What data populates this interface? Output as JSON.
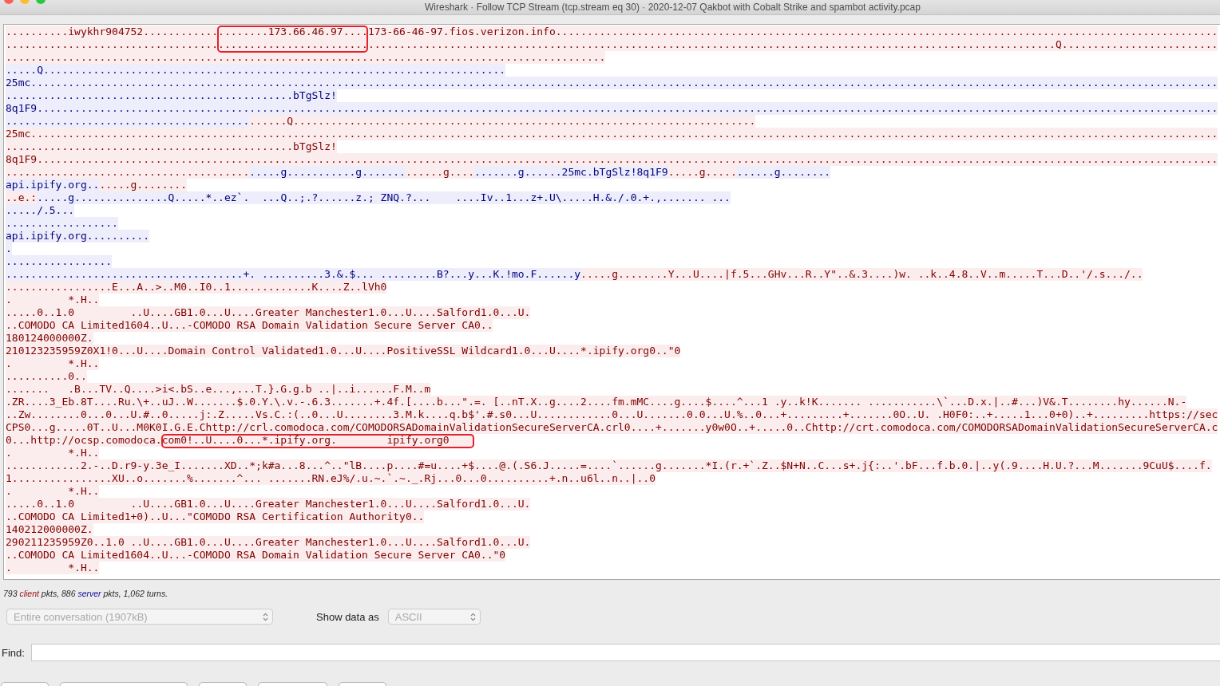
{
  "window": {
    "title": "Wireshark · Follow TCP Stream (tcp.stream eq 30) · 2020-12-07 Qakbot with Cobalt Strike and spambot activity.pcap"
  },
  "stream": {
    "lines": [
      {
        "segments": [
          {
            "kind": "client",
            "boxed": false,
            "text": "..........iwykhr904752............"
          },
          {
            "kind": "client",
            "boxed": true,
            "text": "........173.66.46.97...."
          },
          {
            "kind": "client",
            "boxed": false,
            "text": "173-66-46-97.fios.verizon.info.........................................................................................................."
          }
        ]
      },
      {
        "segments": [
          {
            "kind": "client",
            "boxed": false,
            "text": ".................................."
          },
          {
            "kind": "client",
            "boxed": true,
            "text": "........................"
          },
          {
            "kind": "client",
            "boxed": false,
            "text": "..............................................................................................................Q........................."
          }
        ]
      },
      {
        "segments": [
          {
            "kind": "client",
            "boxed": false,
            "text": "................................................................................................"
          }
        ]
      },
      {
        "segments": [
          {
            "kind": "server",
            "boxed": false,
            "text": ".....Q.........................................................................."
          }
        ]
      },
      {
        "segments": [
          {
            "kind": "server",
            "boxed": false,
            "text": "25mc.............................................................................................................................................................................................."
          }
        ]
      },
      {
        "segments": [
          {
            "kind": "server",
            "boxed": false,
            "text": "..............................................bTgSlz!"
          }
        ]
      },
      {
        "segments": [
          {
            "kind": "server",
            "boxed": false,
            "text": "8q1F9............................................................................................................................................................................................."
          }
        ]
      },
      {
        "segments": [
          {
            "kind": "server",
            "boxed": false,
            "text": "......................................."
          },
          {
            "kind": "client",
            "boxed": false,
            "text": "......Q.........................................................................."
          }
        ]
      },
      {
        "segments": [
          {
            "kind": "client",
            "boxed": false,
            "text": "25mc.............................................................................................................................................................................................."
          }
        ]
      },
      {
        "segments": [
          {
            "kind": "client",
            "boxed": false,
            "text": "..............................................bTgSlz!"
          }
        ]
      },
      {
        "segments": [
          {
            "kind": "client",
            "boxed": false,
            "text": "8q1F9............................................................................................................................................................................................."
          }
        ]
      },
      {
        "segments": [
          {
            "kind": "client",
            "boxed": false,
            "text": "......................................."
          },
          {
            "kind": "server",
            "boxed": false,
            "text": ".....g...........g......."
          },
          {
            "kind": "client",
            "boxed": false,
            "text": "......g...."
          },
          {
            "kind": "server",
            "boxed": false,
            "text": ".......g......25mc.bTgSlz!8q1F9"
          },
          {
            "kind": "client",
            "boxed": false,
            "text": ".....g....."
          },
          {
            "kind": "server",
            "boxed": false,
            "text": "......g........"
          }
        ]
      },
      {
        "segments": [
          {
            "kind": "server",
            "boxed": false,
            "text": "api.ipify.org.."
          },
          {
            "kind": "client",
            "boxed": false,
            "text": ".....g........"
          }
        ]
      },
      {
        "segments": [
          {
            "kind": "client",
            "boxed": false,
            "text": "..e.:"
          },
          {
            "kind": "server",
            "boxed": false,
            "text": ".....g...............Q.....*..ez`.  ...Q..;.?......z.; ZNQ.?...    ....Iv..1...z+.U\\.....H.&./.0.+.,....... ..."
          }
        ]
      },
      {
        "segments": [
          {
            "kind": "server",
            "boxed": false,
            "text": "...../.5..."
          }
        ]
      },
      {
        "segments": [
          {
            "kind": "server",
            "boxed": false,
            "text": ".................."
          }
        ]
      },
      {
        "segments": [
          {
            "kind": "server",
            "boxed": false,
            "text": "api.ipify.org.........."
          }
        ]
      },
      {
        "segments": [
          {
            "kind": "server",
            "boxed": false,
            "text": "."
          }
        ]
      },
      {
        "segments": [
          {
            "kind": "server",
            "boxed": false,
            "text": "................."
          }
        ]
      },
      {
        "segments": [
          {
            "kind": "server",
            "boxed": false,
            "text": "......................................+. ..........3.&.$... .........B?...y...K.!mo.F......y"
          },
          {
            "kind": "client",
            "boxed": false,
            "text": ".....g........Y...U....|f.5...GHv...R..Y\"..&.3....)w. ..k..4.8..V..m.....T...D..'/.s.../.."
          }
        ]
      },
      {
        "segments": [
          {
            "kind": "client",
            "boxed": false,
            "text": ".................E...A..>..M0..I0..1.............K....Z..lVh0"
          }
        ]
      },
      {
        "segments": [
          {
            "kind": "client",
            "boxed": false,
            "text": ".         *.H.."
          }
        ]
      },
      {
        "segments": [
          {
            "kind": "client",
            "boxed": false,
            "text": ".....0..1.0         ..U....GB1.0...U....Greater Manchester1.0...U....Salford1.0...U."
          }
        ]
      },
      {
        "segments": [
          {
            "kind": "client",
            "boxed": false,
            "text": "..COMODO CA Limited1604..U...-COMODO RSA Domain Validation Secure Server CA0.."
          }
        ]
      },
      {
        "segments": [
          {
            "kind": "client",
            "boxed": false,
            "text": "180124000000Z."
          }
        ]
      },
      {
        "segments": [
          {
            "kind": "client",
            "boxed": false,
            "text": "210123235959Z0X1!0...U....Domain Control Validated1.0...U....PositiveSSL Wildcard1.0...U....*.ipify.org0..\"0"
          }
        ]
      },
      {
        "segments": [
          {
            "kind": "client",
            "boxed": false,
            "text": ".         *.H.."
          }
        ]
      },
      {
        "segments": [
          {
            "kind": "client",
            "boxed": false,
            "text": "..........0.."
          }
        ]
      },
      {
        "segments": [
          {
            "kind": "client",
            "boxed": false,
            "text": ".......   .B...TV..Q....>i<.bS..e...,...T.}.G.g.b ..|..i......F.M..m"
          }
        ]
      },
      {
        "segments": [
          {
            "kind": "client",
            "boxed": false,
            "text": ".ZR....3_Eb.8T....Ru.\\+..uJ..W.......$.0.Y.\\.v.-.6.3.......+.4f.[....b...\".=. [..nT.X..g....2....fm.mMC....g....$....^...1 .y..k!K....... ...........\\`...D.x.|..#...)V&.T........hy......N.-"
          }
        ]
      },
      {
        "segments": [
          {
            "kind": "client",
            "boxed": false,
            "text": "..Zw........0...0...U.#..0.....j:.Z.....Vs.C.:(..0...U........3.M.k....q.b$'.#.s0...U............0...U.......0.0...U.%..0...+.........+.......0O..U. .H0F0:..+.....1...0+0)..+.........https://sec"
          }
        ]
      },
      {
        "segments": [
          {
            "kind": "client",
            "boxed": false,
            "text": "CPS0...g.....0T..U...M0K0I.G.E.Chttp://crl.comodoca.com/COMODORSADomainValidationSecureServerCA.crl0....+.......y0w0O..+.....0..Chttp://crt.comodoca.com/COMODORSADomainValidationSecureServerCA.c"
          }
        ]
      },
      {
        "segments": [
          {
            "kind": "client",
            "boxed": false,
            "text": "0...http://ocsp.comodoca."
          },
          {
            "kind": "client",
            "boxed": true,
            "text": "com0!..U....0...*.ipify.org.        ipify.org0    "
          }
        ]
      },
      {
        "segments": [
          {
            "kind": "client",
            "boxed": false,
            "text": ".         *.H.."
          }
        ]
      },
      {
        "segments": [
          {
            "kind": "client",
            "boxed": false,
            "text": "............2.-..D.r9-y.3e_I.......XD..*;k#a...8...^..\"lB....p....#=u....+$....@.(.S6.J.....=....`......g.......*I.(r.+`.Z..$N+N..C...s+.j{:..'.bF...f.b.0.|..y(.9....H.U.?...M.......9CuU$....f."
          }
        ]
      },
      {
        "segments": [
          {
            "kind": "client",
            "boxed": false,
            "text": "1................XU..o.......%.......^... .......RN.eJ%/.u.~.`.~._.Rj...0...0..........+.n..u6l..n..|..0"
          }
        ]
      },
      {
        "segments": [
          {
            "kind": "client",
            "boxed": false,
            "text": ".         *.H.."
          }
        ]
      },
      {
        "segments": [
          {
            "kind": "client",
            "boxed": false,
            "text": ".....0..1.0         ..U....GB1.0...U....Greater Manchester1.0...U....Salford1.0...U."
          }
        ]
      },
      {
        "segments": [
          {
            "kind": "client",
            "boxed": false,
            "text": "..COMODO CA Limited1+0)..U...\"COMODO RSA Certification Authority0.."
          }
        ]
      },
      {
        "segments": [
          {
            "kind": "client",
            "boxed": false,
            "text": "140212000000Z."
          }
        ]
      },
      {
        "segments": [
          {
            "kind": "client",
            "boxed": false,
            "text": "290211235959Z0..1.0 ..U....GB1.0...U....Greater Manchester1.0...U....Salford1.0...U."
          }
        ]
      },
      {
        "segments": [
          {
            "kind": "client",
            "boxed": false,
            "text": "..COMODO CA Limited1604..U...-COMODO RSA Domain Validation Secure Server CA0..\"0"
          }
        ]
      },
      {
        "segments": [
          {
            "kind": "client",
            "boxed": false,
            "text": ".         *.H.."
          }
        ]
      }
    ]
  },
  "summary": [
    {
      "kind": "plain",
      "text": "793 "
    },
    {
      "kind": "client",
      "text": "client"
    },
    {
      "kind": "plain",
      "text": " pkts, 886 "
    },
    {
      "kind": "server",
      "text": "server"
    },
    {
      "kind": "plain",
      "text": " pkts, 1,062 turns."
    }
  ],
  "conversation_select": {
    "value": "Entire conversation (1907kB)",
    "disabled": true
  },
  "data_format": {
    "label": "Show data as",
    "value": "ASCII",
    "disabled": true
  },
  "find": {
    "label": "Find:"
  }
}
